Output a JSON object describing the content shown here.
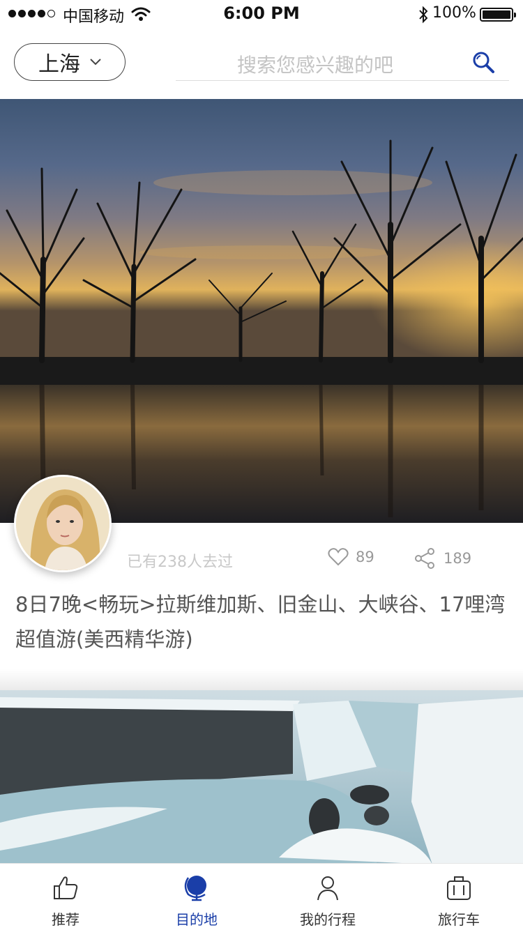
{
  "status_bar": {
    "carrier": "中国移动",
    "time": "6:00 PM",
    "battery": "100%"
  },
  "header": {
    "city": "上海",
    "search_placeholder": "搜索您感兴趣的吧"
  },
  "cards": [
    {
      "visited": "已有238人去过",
      "likes": "89",
      "shares": "189",
      "title": "8日7晚<畅玩>拉斯维加斯、旧金山、大峡谷、17哩湾超值游(美西精华游)"
    }
  ],
  "tabs": [
    {
      "label": "推荐",
      "icon": "thumbs-up-icon"
    },
    {
      "label": "目的地",
      "icon": "globe-icon"
    },
    {
      "label": "我的行程",
      "icon": "user-icon"
    },
    {
      "label": "旅行车",
      "icon": "luggage-icon"
    }
  ],
  "colors": {
    "accent": "#1a3ea8",
    "text_muted": "#c8c8c8"
  }
}
